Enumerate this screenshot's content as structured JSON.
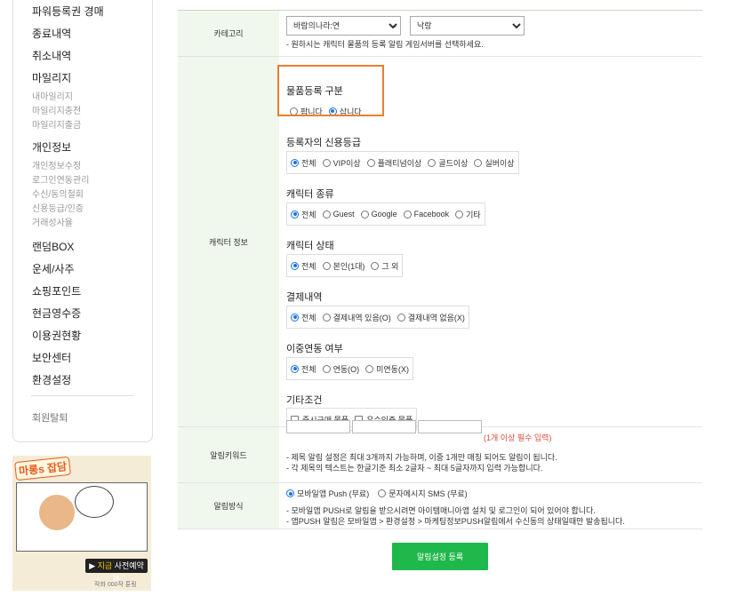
{
  "sidebar": {
    "items": [
      {
        "label": "파워등록권 경매"
      },
      {
        "label": "종료내역"
      },
      {
        "label": "취소내역"
      },
      {
        "label": "마일리지"
      },
      {
        "label": "내마일리지"
      },
      {
        "label": "마일리지충전"
      },
      {
        "label": "마일리지출금"
      },
      {
        "label": "개인정보"
      },
      {
        "label": "개인정보수정"
      },
      {
        "label": "로그인연동관리"
      },
      {
        "label": "수신/동의철회"
      },
      {
        "label": "신용등급/인증"
      },
      {
        "label": "거래성사율"
      },
      {
        "label": "랜덤BOX"
      },
      {
        "label": "운세/사주"
      },
      {
        "label": "쇼핑포인트"
      },
      {
        "label": "현금영수증"
      },
      {
        "label": "이용권현황"
      },
      {
        "label": "보안센터"
      },
      {
        "label": "환경설정"
      }
    ],
    "withdraw": "회원탈퇴"
  },
  "banner": {
    "title": "마롱s 잡담",
    "cta_prefix": "지금",
    "cta_text": " 사전예약 중",
    "credit": "작화 000작 툰링"
  },
  "form": {
    "category": {
      "label": "카테고리",
      "game_select": "바람의나라:연",
      "server_select": "낙랑",
      "note": "- 원하시는 캐릭터 물품의 등록 알림 게임서버를 선택하세요."
    },
    "character": {
      "label": "캐릭터 정보",
      "groups": [
        {
          "title": "물품등록 구분",
          "options": [
            {
              "label": "팝니다",
              "checked": false
            },
            {
              "label": "삽니다",
              "checked": true
            }
          ]
        },
        {
          "title": "등록자의 신용등급",
          "options": [
            {
              "label": "전체",
              "checked": true
            },
            {
              "label": "VIP이상",
              "checked": false
            },
            {
              "label": "플래티넘이상",
              "checked": false
            },
            {
              "label": "골드이상",
              "checked": false
            },
            {
              "label": "실버이상",
              "checked": false
            }
          ]
        },
        {
          "title": "캐릭터 종류",
          "options": [
            {
              "label": "전체",
              "checked": true
            },
            {
              "label": "Guest",
              "checked": false
            },
            {
              "label": "Google",
              "checked": false
            },
            {
              "label": "Facebook",
              "checked": false
            },
            {
              "label": "기타",
              "checked": false
            }
          ]
        },
        {
          "title": "캐릭터 상태",
          "options": [
            {
              "label": "전체",
              "checked": true
            },
            {
              "label": "본인(1대)",
              "checked": false
            },
            {
              "label": "그 외",
              "checked": false
            }
          ]
        },
        {
          "title": "결제내역",
          "options": [
            {
              "label": "전체",
              "checked": true
            },
            {
              "label": "결제내역 있음(O)",
              "checked": false
            },
            {
              "label": "결제내역 없음(X)",
              "checked": false
            }
          ]
        },
        {
          "title": "이중연동 여부",
          "options": [
            {
              "label": "전체",
              "checked": true
            },
            {
              "label": "연동(O)",
              "checked": false
            },
            {
              "label": "미연동(X)",
              "checked": false
            }
          ]
        },
        {
          "title": "기타조건",
          "options": [
            {
              "label": "즉시구매 물품",
              "checked": false
            },
            {
              "label": "우수인증 물품",
              "checked": false
            }
          ]
        }
      ]
    },
    "keyword": {
      "label": "알림키워드",
      "required": "(1개 이상 필수 입력)",
      "note1": "- 제목 알림 설정은 최대 3개까지 가능하며, 이중 1개만 매칭 되어도 알림이 됩니다.",
      "note2": "- 각 제목의 텍스트는 한글기준 최소 2글자 ~ 최대 5글자까지 입력 가능합니다."
    },
    "method": {
      "label": "알림방식",
      "options": [
        {
          "label": "모바일앱 Push (무료)",
          "checked": true
        },
        {
          "label": "문자메시지 SMS (무료)",
          "checked": false
        }
      ],
      "note1": "- 모바일앱 PUSH로 알림을 받으시려면 아이템매니아앱 설치 및 로그인이 되어 있어야 합니다.",
      "note2": "- 앱PUSH 알림은 모바일앱 > 환경설정 > 마케팅정보PUSH알림에서 수신동의 상태일때만 발송됩니다."
    },
    "submit": "알림설정 등록"
  },
  "colors": {
    "accent_green": "#1fb84b",
    "highlight": "#ee7d2d",
    "required_red": "#e04a3a",
    "radio_blue": "#1a73e8"
  }
}
